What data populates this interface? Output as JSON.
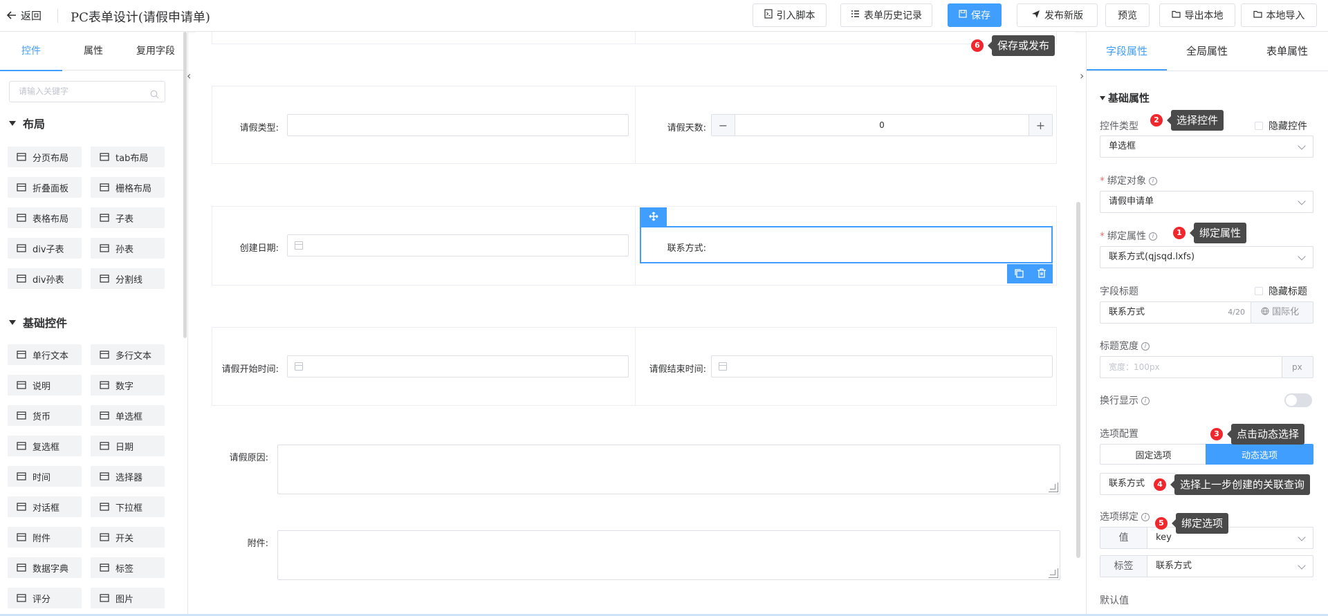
{
  "header": {
    "back_label": "返回",
    "title": "PC表单设计(请假申请单)",
    "buttons": {
      "import_script": "引入脚本",
      "history": "表单历史记录",
      "save": "保存",
      "publish": "发布新版",
      "preview": "预览",
      "export": "导出本地",
      "import": "本地导入"
    }
  },
  "left_panel": {
    "tabs": [
      "控件",
      "属性",
      "复用字段"
    ],
    "active_tab": "控件",
    "search_placeholder": "请输入关键字",
    "sections": [
      {
        "title": "布局",
        "items": [
          {
            "label": "分页布局",
            "icon": "page-layout-icon"
          },
          {
            "label": "tab布局",
            "icon": "tab-layout-icon"
          },
          {
            "label": "折叠面板",
            "icon": "collapse-panel-icon"
          },
          {
            "label": "栅格布局",
            "icon": "grid-layout-icon"
          },
          {
            "label": "表格布局",
            "icon": "table-layout-icon"
          },
          {
            "label": "子表",
            "icon": "subtable-icon"
          },
          {
            "label": "div子表",
            "icon": "div-subtable-icon"
          },
          {
            "label": "孙表",
            "icon": "grandchild-table-icon"
          },
          {
            "label": "div孙表",
            "icon": "div-grandchild-table-icon"
          },
          {
            "label": "分割线",
            "icon": "divider-icon"
          }
        ]
      },
      {
        "title": "基础控件",
        "items": [
          {
            "label": "单行文本",
            "icon": "single-line-text-icon"
          },
          {
            "label": "多行文本",
            "icon": "multi-line-text-icon"
          },
          {
            "label": "说明",
            "icon": "description-icon"
          },
          {
            "label": "数字",
            "icon": "number-icon"
          },
          {
            "label": "货币",
            "icon": "currency-icon"
          },
          {
            "label": "单选框",
            "icon": "radio-icon"
          },
          {
            "label": "复选框",
            "icon": "checkbox-icon"
          },
          {
            "label": "日期",
            "icon": "date-icon"
          },
          {
            "label": "时间",
            "icon": "time-icon"
          },
          {
            "label": "选择器",
            "icon": "selector-icon"
          },
          {
            "label": "对话框",
            "icon": "dialog-icon"
          },
          {
            "label": "下拉框",
            "icon": "dropdown-icon"
          },
          {
            "label": "附件",
            "icon": "attachment-icon"
          },
          {
            "label": "开关",
            "icon": "switch-icon"
          },
          {
            "label": "数据字典",
            "icon": "data-dictionary-icon"
          },
          {
            "label": "标签",
            "icon": "tag-icon"
          },
          {
            "label": "评分",
            "icon": "rate-icon"
          },
          {
            "label": "图片",
            "icon": "image-icon"
          }
        ]
      }
    ]
  },
  "canvas": {
    "fields": {
      "leave_type": "请假类型:",
      "leave_days": "请假天数:",
      "leave_days_value": "0",
      "create_date": "创建日期:",
      "contact": "联系方式:",
      "start_time": "请假开始时间:",
      "end_time": "请假结束时间:",
      "reason": "请假原因:",
      "attachment": "附件:"
    }
  },
  "right_panel": {
    "tabs": [
      "字段属性",
      "全局属性",
      "表单属性"
    ],
    "active_tab": "字段属性",
    "section_title": "基础属性",
    "control_type_label": "控件类型",
    "hide_control_label": "隐藏控件",
    "control_type_value": "单选框",
    "bind_object_label": "绑定对象",
    "bind_object_value": "请假申请单",
    "bind_attr_label": "绑定属性",
    "bind_attr_value": "联系方式(qjsqd.lxfs)",
    "field_title_label": "字段标题",
    "hide_title_label": "隐藏标题",
    "field_title_value": "联系方式",
    "field_title_count": "4/20",
    "i18n_label": "国际化",
    "title_width_label": "标题宽度",
    "title_width_placeholder": "宽度：100px",
    "title_width_unit": "px",
    "wrap_display_label": "换行显示",
    "wrap_display_on": false,
    "options_config_label": "选项配置",
    "fixed_options": "固定选项",
    "dynamic_options": "动态选项",
    "query_value": "联系方式",
    "options_binding_label": "选项绑定",
    "value_prefix": "值",
    "value_select": "key",
    "label_prefix": "标签",
    "label_select": "联系方式",
    "default_value_label": "默认值"
  },
  "annotations": [
    {
      "num": "1",
      "text": "绑定属性"
    },
    {
      "num": "2",
      "text": "选择控件"
    },
    {
      "num": "3",
      "text": "点击动态选择"
    },
    {
      "num": "4",
      "text": "选择上一步创建的关联查询"
    },
    {
      "num": "5",
      "text": "绑定选项"
    },
    {
      "num": "6",
      "text": "保存或发布"
    }
  ],
  "colors": {
    "accent": "#409eff",
    "badge": "#f0282d",
    "tooltip_bg": "#4a4a4a"
  }
}
